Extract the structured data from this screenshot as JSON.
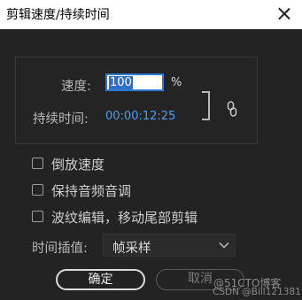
{
  "dialog": {
    "title": "剪辑速度/持续时间"
  },
  "speed": {
    "label": "速度:",
    "value": "100",
    "unit": "%"
  },
  "duration": {
    "label": "持续时间:",
    "timecode": "00:00:12:25"
  },
  "checkboxes": [
    {
      "label": "倒放速度",
      "checked": false
    },
    {
      "label": "保持音频音调",
      "checked": false
    },
    {
      "label": "波纹编辑，移动尾部剪辑",
      "checked": false
    }
  ],
  "interpolation": {
    "label": "时间插值:",
    "selected": "帧采样"
  },
  "buttons": {
    "ok": "确定",
    "cancel": "取消"
  },
  "watermark": {
    "line1": "@51CTO博客",
    "line2": "CSDN @Bill121381"
  },
  "colors": {
    "accent": "#2d79d6",
    "timecode": "#4a9ff0",
    "background": "#232323"
  },
  "icons": {
    "close": "close-icon",
    "link": "link-icon",
    "dropdown": "chevron-down-icon"
  }
}
